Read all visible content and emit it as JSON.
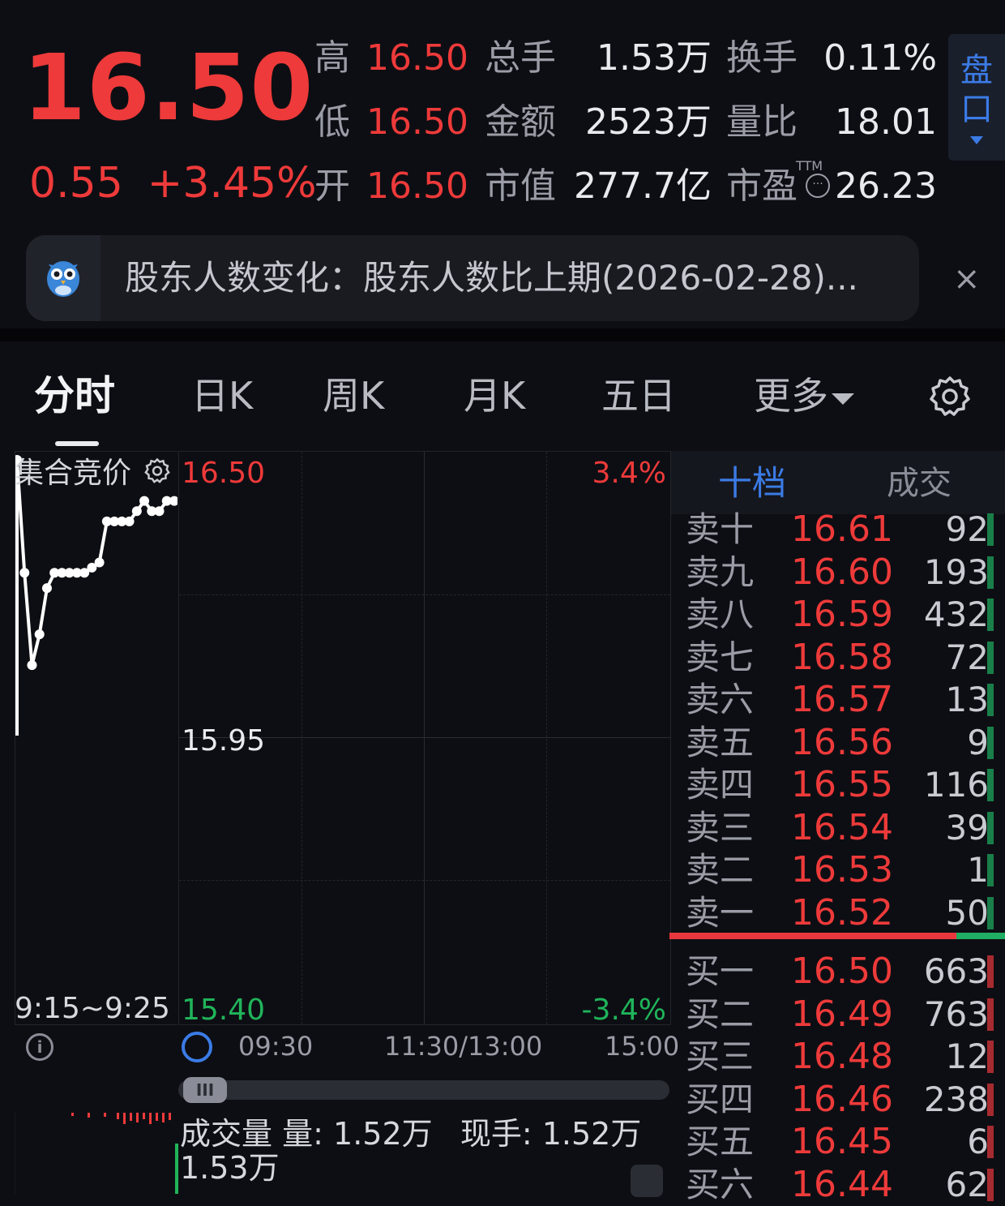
{
  "quote": {
    "price": "16.50",
    "change": "0.55",
    "change_pct": "+3.45%",
    "high_label": "高",
    "high": "16.50",
    "low_label": "低",
    "low": "16.50",
    "open_label": "开",
    "open": "16.50",
    "volume_label": "总手",
    "volume": "1.53万",
    "amount_label": "金额",
    "amount": "2523万",
    "market_cap_label": "市值",
    "market_cap": "277.7亿",
    "turnover_label": "换手",
    "turnover": "0.11%",
    "volume_ratio_label": "量比",
    "volume_ratio": "18.01",
    "pe_label": "市盈",
    "pe_badge": "TTM",
    "pe": "26.23",
    "pankou_label_1": "盘",
    "pankou_label_2": "口"
  },
  "notice": {
    "text": "股东人数变化：股东人数比上期(2026-02-28)...",
    "close": "×"
  },
  "tabs": [
    "分时",
    "日K",
    "周K",
    "月K",
    "五日",
    "更多"
  ],
  "chart": {
    "auction_title": "集合竞价",
    "auction_time": "9:15~9:25",
    "price_top": "16.50",
    "price_mid": "15.95",
    "price_bottom": "15.40",
    "pct_top": "3.4%",
    "pct_bottom": "-3.4%",
    "times": [
      "09:30",
      "11:30/13:00",
      "15:00"
    ]
  },
  "chart_data": {
    "type": "line",
    "title": "集合竞价",
    "xlabel": "9:15~9:25",
    "ylim": [
      15.4,
      16.5
    ],
    "y": [
      16.5,
      16.28,
      16.1,
      16.16,
      16.25,
      16.28,
      16.28,
      16.28,
      16.28,
      16.28,
      16.29,
      16.3,
      16.38,
      16.38,
      16.38,
      16.38,
      16.4,
      16.42,
      16.4,
      16.4,
      16.42,
      16.42
    ]
  },
  "orderbook": {
    "tab_active": "十档",
    "tab_other": "成交",
    "asks": [
      {
        "label": "卖十",
        "price": "16.61",
        "vol": "92"
      },
      {
        "label": "卖九",
        "price": "16.60",
        "vol": "193"
      },
      {
        "label": "卖八",
        "price": "16.59",
        "vol": "432"
      },
      {
        "label": "卖七",
        "price": "16.58",
        "vol": "72"
      },
      {
        "label": "卖六",
        "price": "16.57",
        "vol": "13"
      },
      {
        "label": "卖五",
        "price": "16.56",
        "vol": "9"
      },
      {
        "label": "卖四",
        "price": "16.55",
        "vol": "116"
      },
      {
        "label": "卖三",
        "price": "16.54",
        "vol": "39"
      },
      {
        "label": "卖二",
        "price": "16.53",
        "vol": "1"
      },
      {
        "label": "卖一",
        "price": "16.52",
        "vol": "50"
      }
    ],
    "bids": [
      {
        "label": "买一",
        "price": "16.50",
        "vol": "663"
      },
      {
        "label": "买二",
        "price": "16.49",
        "vol": "763"
      },
      {
        "label": "买三",
        "price": "16.48",
        "vol": "12"
      },
      {
        "label": "买四",
        "price": "16.46",
        "vol": "238"
      },
      {
        "label": "买五",
        "price": "16.45",
        "vol": "6"
      },
      {
        "label": "买六",
        "price": "16.44",
        "vol": "62"
      }
    ]
  },
  "volume": {
    "title": "成交量",
    "qty_label": "量:",
    "qty": "1.52万",
    "current_label": "现手:",
    "current": "1.52万",
    "axis_max": "1.53万"
  },
  "colors": {
    "up": "#ee3a3a",
    "down": "#20b45a",
    "accent": "#3b7be6"
  }
}
